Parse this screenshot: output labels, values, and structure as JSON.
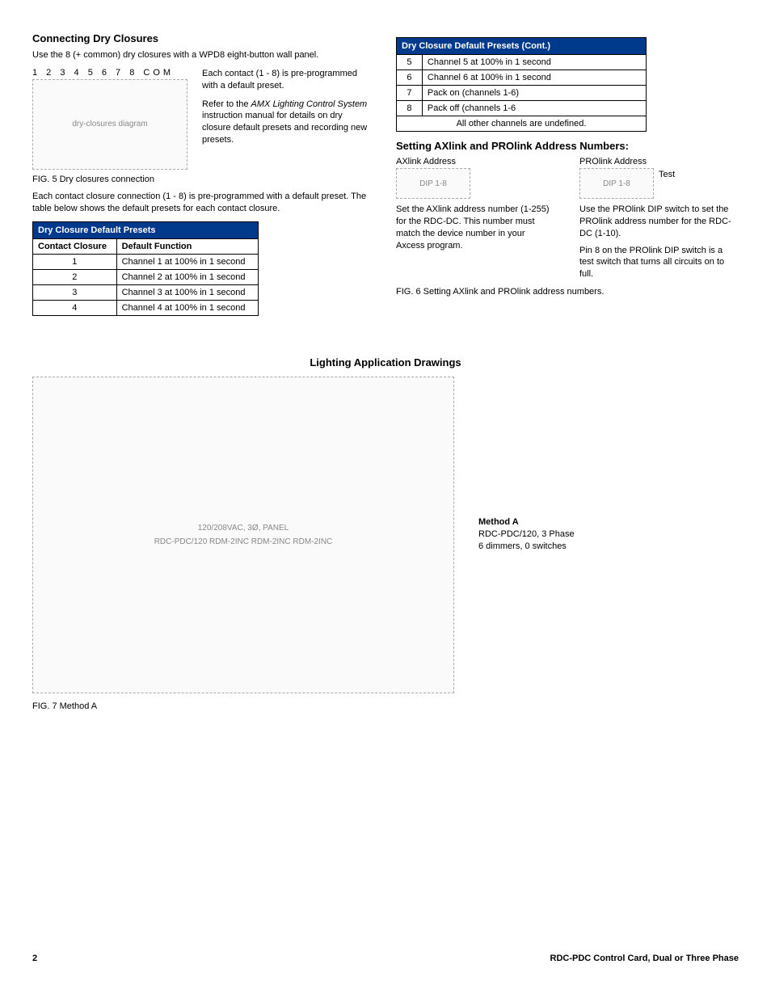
{
  "leftCol": {
    "heading": "Connecting Dry Closures",
    "intro": "Use the 8 (+ common) dry closures with a WPD8 eight-button wall panel.",
    "fig5_labels": "1   2   3   4   5   6   7   8   COM",
    "side_p1": "Each contact (1 - 8) is pre-programmed with a default preset.",
    "side_p2a": "Refer to the ",
    "side_p2_em": "AMX Lighting Control System",
    "side_p2b": " instruction manual for details on dry closure default presets and recording new presets.",
    "fig5_caption": "FIG. 5  Dry closures connection",
    "afterFig5": "Each contact closure connection (1 - 8) is pre-programmed with a default preset. The table below shows the default presets for each contact closure.",
    "table1": {
      "title": "Dry Closure Default Presets",
      "col1": "Contact Closure",
      "col2": "Default Function",
      "rows": [
        {
          "c": "1",
          "f": "Channel 1 at 100% in 1 second"
        },
        {
          "c": "2",
          "f": "Channel 2 at 100% in 1 second"
        },
        {
          "c": "3",
          "f": "Channel 3 at 100% in 1 second"
        },
        {
          "c": "4",
          "f": "Channel 4 at 100% in 1 second"
        }
      ]
    }
  },
  "rightCol": {
    "table2": {
      "title": "Dry Closure Default Presets (Cont.)",
      "rows": [
        {
          "c": "5",
          "f": "Channel 5 at 100% in 1 second"
        },
        {
          "c": "6",
          "f": "Channel 6 at 100% in 1 second"
        },
        {
          "c": "7",
          "f": "Pack on (channels 1-6)"
        },
        {
          "c": "8",
          "f": "Pack off (channels 1-6"
        }
      ],
      "footer": "All other channels are undefined."
    },
    "heading2": "Setting AXlink and PROlink Address Numbers:",
    "axlink_label": "AXlink Address",
    "prolink_label": "PROlink Address",
    "test_label": "Test",
    "ax_note": "Set the AXlink address number (1-255) for the RDC-DC. This number must match the device number in your Axcess program.",
    "pro_note1": "Use the PROlink DIP switch to set the PROlink address number for the RDC-DC (1-10).",
    "pro_note2": "Pin 8 on the PROlink DIP switch is a test switch that turns all circuits on to full.",
    "fig6_caption": "FIG. 6  Setting AXlink and PROlink address numbers."
  },
  "section2": {
    "heading": "Lighting Application Drawings",
    "method_title": "Method A",
    "method_l1": "RDC-PDC/120, 3 Phase",
    "method_l2": "6 dimmers, 0 switches",
    "fig7_caption": "FIG. 7  Method A",
    "panel_label": "120/208VAC, 3Ø, PANEL",
    "unit_labels": "RDC-PDC/120   RDM-2INC   RDM-2INC   RDM-2INC"
  },
  "footer": {
    "page": "2",
    "title": "RDC-PDC Control Card, Dual or Three Phase"
  }
}
